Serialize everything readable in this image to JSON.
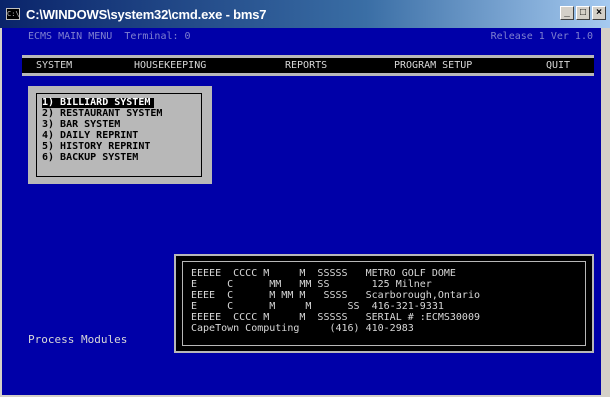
{
  "window": {
    "title": "C:\\WINDOWS\\system32\\cmd.exe - bms7",
    "icon": "console-icon",
    "buttons": {
      "minimize": "_",
      "maximize": "□",
      "close": "×"
    }
  },
  "console": {
    "header_left": "ECMS MAIN MENU  Terminal: 0",
    "header_right": "Release 1 Ver 1.0",
    "menu": [
      {
        "label": "SYSTEM"
      },
      {
        "label": "HOUSEKEEPING"
      },
      {
        "label": "REPORTS"
      },
      {
        "label": "PROGRAM SETUP"
      },
      {
        "label": "QUIT"
      }
    ],
    "submenu": [
      {
        "label": "1) BILLIARD SYSTEM",
        "selected": true
      },
      {
        "label": "2) RESTAURANT SYSTEM",
        "selected": false
      },
      {
        "label": "3) BAR SYSTEM",
        "selected": false
      },
      {
        "label": "4) DAILY REPRINT",
        "selected": false
      },
      {
        "label": "5) HISTORY REPRINT",
        "selected": false
      },
      {
        "label": "6) BACKUP SYSTEM",
        "selected": false
      }
    ],
    "info_lines": [
      "EEEEE  CCCC M     M  SSSSS   METRO GOLF DOME",
      "E     C      MM   MM SS       125 Milner",
      "EEEE  C      M MM M   SSSS   Scarborough,Ontario",
      "E     C      M     M      SS  416-321-9331",
      "EEEEE  CCCC M     M  SSSSS   SERIAL # :ECMS30009",
      "CapeTown Computing     (416) 410-2983"
    ],
    "status": "Process Modules"
  }
}
